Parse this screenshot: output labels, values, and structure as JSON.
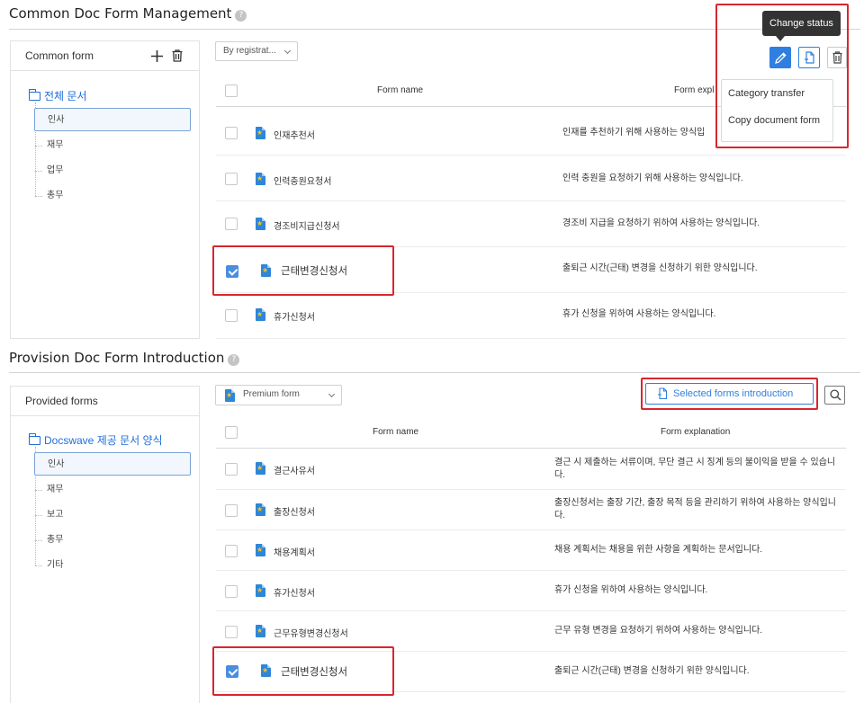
{
  "common": {
    "title": "Common Doc Form Management",
    "panel_title": "Common form",
    "root_folder": "전체 문서",
    "categories": [
      "인사",
      "재무",
      "업무",
      "총무"
    ],
    "sort_select": "By registrat...",
    "col_name": "Form name",
    "col_explanation": "Form expl",
    "rows": [
      {
        "name": "인재추천서",
        "explanation": "인재를 추천하기 위해 사용하는 양식입",
        "checked": false
      },
      {
        "name": "인력충원요청서",
        "explanation": "인력 충원을 요청하기 위해 사용하는 양식입니다.",
        "checked": false
      },
      {
        "name": "경조비지급신청서",
        "explanation": "경조비 지급을 요청하기 위하여 사용하는 양식입니다.",
        "checked": false
      },
      {
        "name": "근태변경신청서",
        "explanation": "출퇴근 시간(근태) 변경을 신청하기 위한 양식입니다.",
        "checked": true
      },
      {
        "name": "휴가신청서",
        "explanation": "휴가 신청을 위하여 사용하는 양식입니다.",
        "checked": false
      }
    ],
    "tooltip": "Change status",
    "menu": [
      "Category transfer",
      "Copy document form"
    ]
  },
  "provision": {
    "title": "Provision Doc Form Introduction",
    "panel_title": "Provided forms",
    "root_folder": "Docswave 제공 문서 양식",
    "categories": [
      "인사",
      "재무",
      "보고",
      "총무",
      "기타"
    ],
    "type_select": "Premium form",
    "intro_button": "Selected forms introduction",
    "col_name": "Form name",
    "col_explanation": "Form explanation",
    "rows": [
      {
        "name": "결근사유서",
        "explanation": "결근 시 제출하는 서류이며, 무단 결근 시 징계 등의 불이익을 받을 수 있습니다.",
        "checked": false
      },
      {
        "name": "출장신청서",
        "explanation": "출장신청서는 출장 기간, 출장 목적 등을 관리하기 위하여 사용하는 양식입니다.",
        "checked": false
      },
      {
        "name": "채용계획서",
        "explanation": "채용 계획서는 채용을 위한 사항을 계획하는 문서입니다.",
        "checked": false
      },
      {
        "name": "휴가신청서",
        "explanation": "휴가 신청을 위하여 사용하는 양식입니다.",
        "checked": false
      },
      {
        "name": "근무유형변경신청서",
        "explanation": "근무 유형 변경을 요청하기 위하여 사용하는 양식입니다.",
        "checked": false
      },
      {
        "name": "근태변경신청서",
        "explanation": "출퇴근 시간(근태) 변경을 신청하기 위한 양식입니다.",
        "checked": true
      }
    ]
  },
  "icons": {
    "help": "help-icon",
    "add": "plus-icon",
    "delete": "trash-icon",
    "edit": "pencil-icon",
    "copy": "copy-doc-icon",
    "search": "search-icon",
    "folder": "folder-icon",
    "doc": "document-icon"
  },
  "colors": {
    "accent": "#2f7fe0",
    "highlight": "#d9262e",
    "folder": "#1e6fd9"
  }
}
